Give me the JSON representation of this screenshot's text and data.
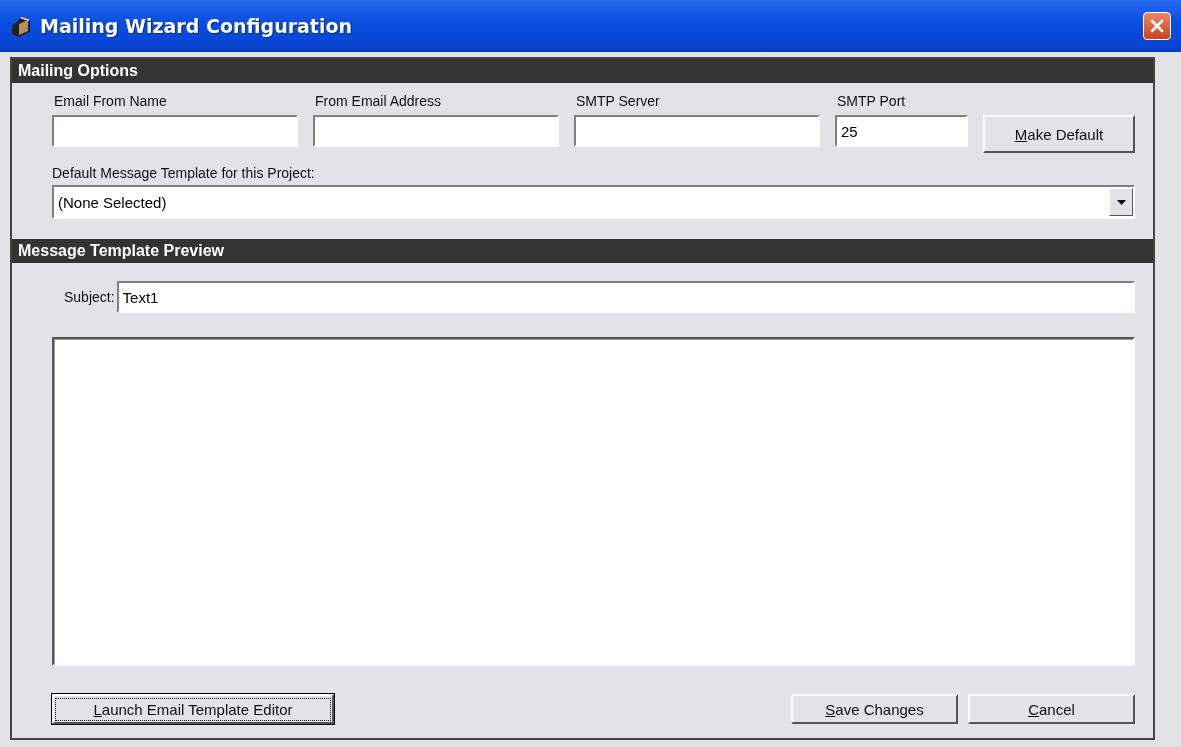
{
  "window": {
    "title": "Mailing Wizard Configuration"
  },
  "mailing_options": {
    "heading": "Mailing Options",
    "fields": [
      {
        "label": "Email From Name"
      },
      {
        "label": "From Email Address"
      },
      {
        "label": "SMTP Server"
      },
      {
        "label": "SMTP Port",
        "value": "25"
      }
    ],
    "make_default_button": {
      "label": "Make Default",
      "mnemonic": true,
      "focused": false
    },
    "template_label": "Default Message Template for this Project:",
    "template_dropdown": {
      "value": "(None Selected)"
    }
  },
  "preview": {
    "heading": "Message Template Preview",
    "subject_label": "Subject:",
    "subject_value": "Text1"
  },
  "buttons": [
    {
      "label": "Launch Email Template Editor",
      "mnemonic": true,
      "focused": true,
      "kind": "left"
    },
    {
      "label": "Save Changes",
      "mnemonic": true,
      "focused": false,
      "kind": "right"
    },
    {
      "label": "Cancel",
      "mnemonic": true,
      "focused": false,
      "kind": "right"
    }
  ]
}
